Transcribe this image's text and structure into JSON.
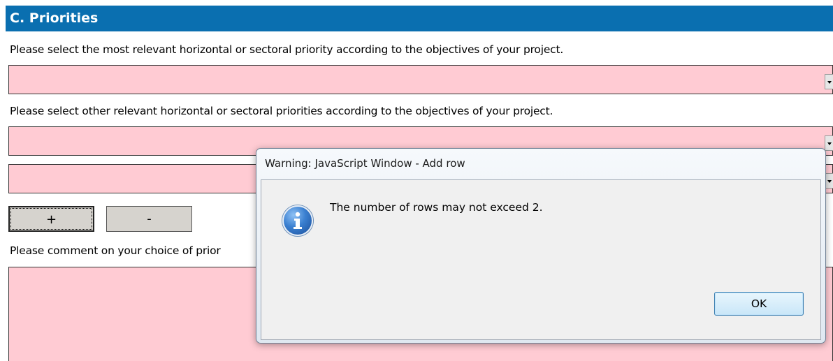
{
  "section": {
    "title": "C. Priorities"
  },
  "form": {
    "main_priority_label": "Please select the most relevant horizontal or sectoral priority according to the objectives of your project.",
    "other_priorities_label": "Please select other relevant horizontal or sectoral priorities according to the objectives of your project.",
    "add_row_label": "+",
    "remove_row_label": "-",
    "comment_label": "Please comment on your choice of prior"
  },
  "dialog": {
    "title": "Warning: JavaScript Window - Add row",
    "message": "The number of rows may not exceed 2.",
    "ok_label": "OK",
    "icon": "info-icon"
  },
  "colors": {
    "header_bg": "#0a6fb0",
    "field_bg": "#ffcbd3"
  }
}
